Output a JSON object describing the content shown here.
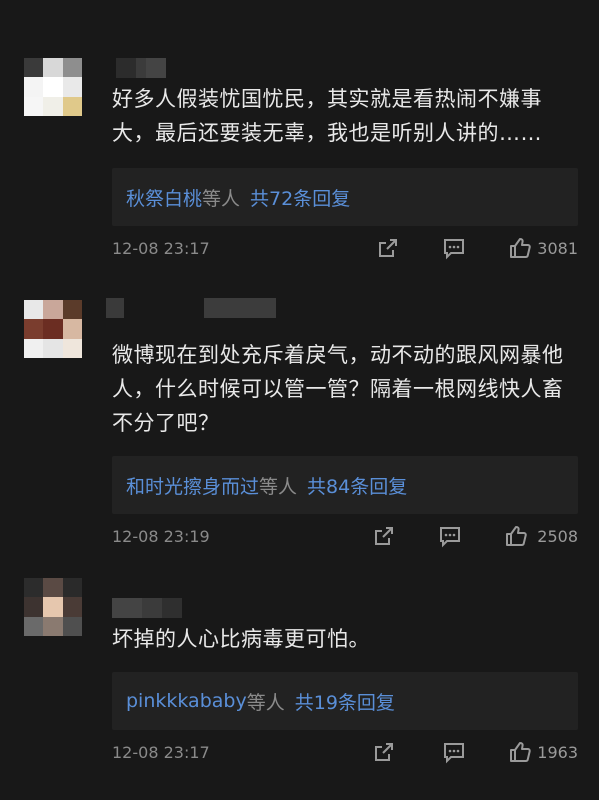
{
  "comments": [
    {
      "text": "好多人假装忧国忧民，其实就是看热闹不嫌事大，最后还要装无辜，我也是听别人讲的……",
      "reply_users": "秋祭白桃",
      "reply_etc": "等人",
      "reply_count": "共72条回复",
      "time": "12-08 23:17",
      "likes": "3081"
    },
    {
      "text": "微博现在到处充斥着戾气，动不动的跟风网暴他人，什么时候可以管一管？隔着一根网线快人畜不分了吧？",
      "reply_users": "和时光擦身而过",
      "reply_etc": "等人",
      "reply_count": "共84条回复",
      "time": "12-08 23:19",
      "likes": "2508"
    },
    {
      "text": "坏掉的人心比病毒更可怕。",
      "reply_users": "pinkkkababy",
      "reply_etc": "等人",
      "reply_count": "共19条回复",
      "time": "12-08 23:17",
      "likes": "1963"
    }
  ],
  "icons": [
    "share-icon",
    "comment-icon",
    "thumbs-up-icon"
  ],
  "colors": {
    "background": "#181818",
    "link": "#5a8fd8",
    "meta": "#8a8a8a",
    "reply_bg": "#222222"
  }
}
